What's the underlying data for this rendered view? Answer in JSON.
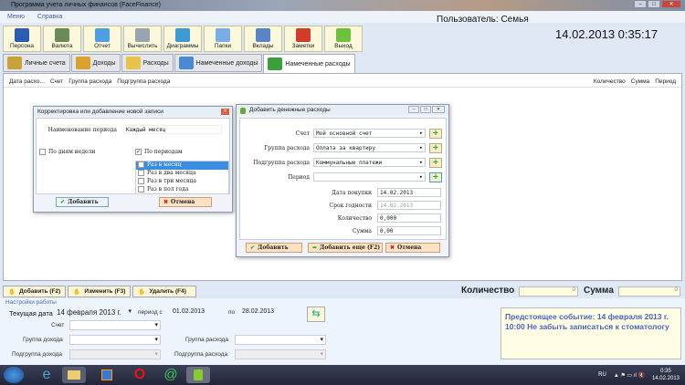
{
  "window": {
    "title": "Программа учета личных финансов (FaceFinance)"
  },
  "menu": [
    "Меню",
    "Справка"
  ],
  "toolbar": [
    {
      "label": "Персона",
      "icon": "people-icon",
      "color": "#2a5db0"
    },
    {
      "label": "Валюта",
      "icon": "money-icon",
      "color": "#6b8a5a"
    },
    {
      "label": "Отчет",
      "icon": "bar-chart-icon",
      "color": "#4aa0e0"
    },
    {
      "label": "Вычислить",
      "icon": "calculator-icon",
      "color": "#9aa4b0"
    },
    {
      "label": "Диаграммы",
      "icon": "pie-chart-icon",
      "color": "#3d9ad0"
    },
    {
      "label": "Папки",
      "icon": "folder-icon",
      "color": "#78aee8"
    },
    {
      "label": "Вклады",
      "icon": "line-chart-icon",
      "color": "#5a84c8"
    },
    {
      "label": "Заметки",
      "icon": "calendar-icon",
      "color": "#d23a2a"
    },
    {
      "label": "Выход",
      "icon": "exit-arrow-icon",
      "color": "#6cc23a"
    }
  ],
  "header": {
    "user": "Пользователь: Семья",
    "datetime": "14.02.2013  0:35:17"
  },
  "tabs": [
    {
      "label": "Личные счета",
      "icon": "safe-icon",
      "color": "#c9a23a"
    },
    {
      "label": "Доходы",
      "icon": "coins-icon",
      "color": "#d9a22a"
    },
    {
      "label": "Расходы",
      "icon": "wallet-icon",
      "color": "#e8c24a"
    },
    {
      "label": "Намеченные доходы",
      "icon": "money-planned-icon",
      "color": "#4a8ad0"
    },
    {
      "label": "Намеченные расходы",
      "icon": "basket-icon",
      "color": "#3aa03a"
    }
  ],
  "grid": {
    "columns_left": [
      "Дата расхо...",
      "Счет",
      "Группа расхода",
      "Подгруппа расхода"
    ],
    "columns_right": [
      "Количество",
      "Сумма",
      "Период"
    ]
  },
  "period_dialog": {
    "title": "Корректировка или добавление новой записи",
    "name_label": "Наименование периода",
    "name_value": "Каждый месяц",
    "by_weekdays": "По дням недели",
    "by_periods": "По периодам",
    "periods": [
      {
        "label": "Раз в месяц",
        "checked": true
      },
      {
        "label": "Раз в два месяца",
        "checked": false
      },
      {
        "label": "Раз в три месяца",
        "checked": false
      },
      {
        "label": "Раз в пол года",
        "checked": false
      }
    ],
    "add": "Добавить",
    "cancel": "Отмена"
  },
  "expense_dialog": {
    "title": "Добавить денежные расходы",
    "account_label": "Счет",
    "account_value": "Мой основной счет",
    "group_label": "Группа расхода",
    "group_value": "Оплата за квартиру",
    "subgroup_label": "Подгруппа расхода",
    "subgroup_value": "Коммунальные платежи",
    "period_label": "Период",
    "period_value": "",
    "date_label": "Дата покупки",
    "date_value": "14.02.2013",
    "expiry_label": "Срок годности",
    "expiry_value": "14.02.2013",
    "qty_label": "Количество",
    "qty_value": "0,000",
    "sum_label": "Сумма",
    "sum_value": "0,00",
    "add": "Добавить",
    "add_more": "Добавить еще (F2)",
    "cancel": "Отмена"
  },
  "actions": {
    "add": "Добавить (F2)",
    "edit": "Изменить (F3)",
    "delete": "Удалить (F4)"
  },
  "totals": {
    "qty_label": "Количество",
    "qty_value": "0",
    "sum_label": "Сумма",
    "sum_value": "0"
  },
  "settings": {
    "title": "Настройки работы",
    "current_date_label": "Текущая дата",
    "current_date": "14 февраля 2013 г.",
    "period_from_label": "период с",
    "period_from": "01.02.2013",
    "period_to_label": "по",
    "period_to": "28.02.2013",
    "account_label": "Счет",
    "income_group_label": "Группа дохода",
    "income_subgroup_label": "Подгруппа дохода",
    "expense_group_label": "Группа расхода",
    "expense_subgroup_label": "Подгруппа расхода"
  },
  "event": "Предстоящее событие: 14 февраля 2013 г. 10:00 Не забыть записаться к стоматологу",
  "taskbar": {
    "lang": "RU",
    "time": "0:35",
    "date": "14.02.2013"
  }
}
